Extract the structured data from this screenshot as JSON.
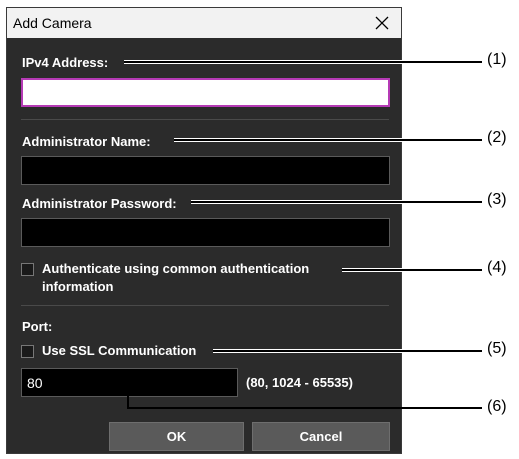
{
  "dialog": {
    "title": "Add Camera",
    "close_icon": "close-icon"
  },
  "fields": {
    "ipv4_label": "IPv4 Address:",
    "ipv4_value": "",
    "admin_name_label": "Administrator Name:",
    "admin_name_value": "",
    "admin_password_label": "Administrator Password:",
    "admin_password_value": ""
  },
  "auth": {
    "checkbox_label_line1": "Authenticate using common authentication",
    "checkbox_label_line2": "information",
    "checked": false
  },
  "port": {
    "label": "Port:",
    "ssl_label": "Use SSL Communication",
    "ssl_checked": false,
    "value": "80",
    "range_hint": "(80, 1024 - 65535)"
  },
  "buttons": {
    "ok": "OK",
    "cancel": "Cancel"
  },
  "callouts": [
    "(1)",
    "(2)",
    "(3)",
    "(4)",
    "(5)",
    "(6)"
  ],
  "colors": {
    "dialog_bg": "#2b2b2b",
    "focus_border": "#b53ab5",
    "button_bg": "#5a5a5a"
  }
}
